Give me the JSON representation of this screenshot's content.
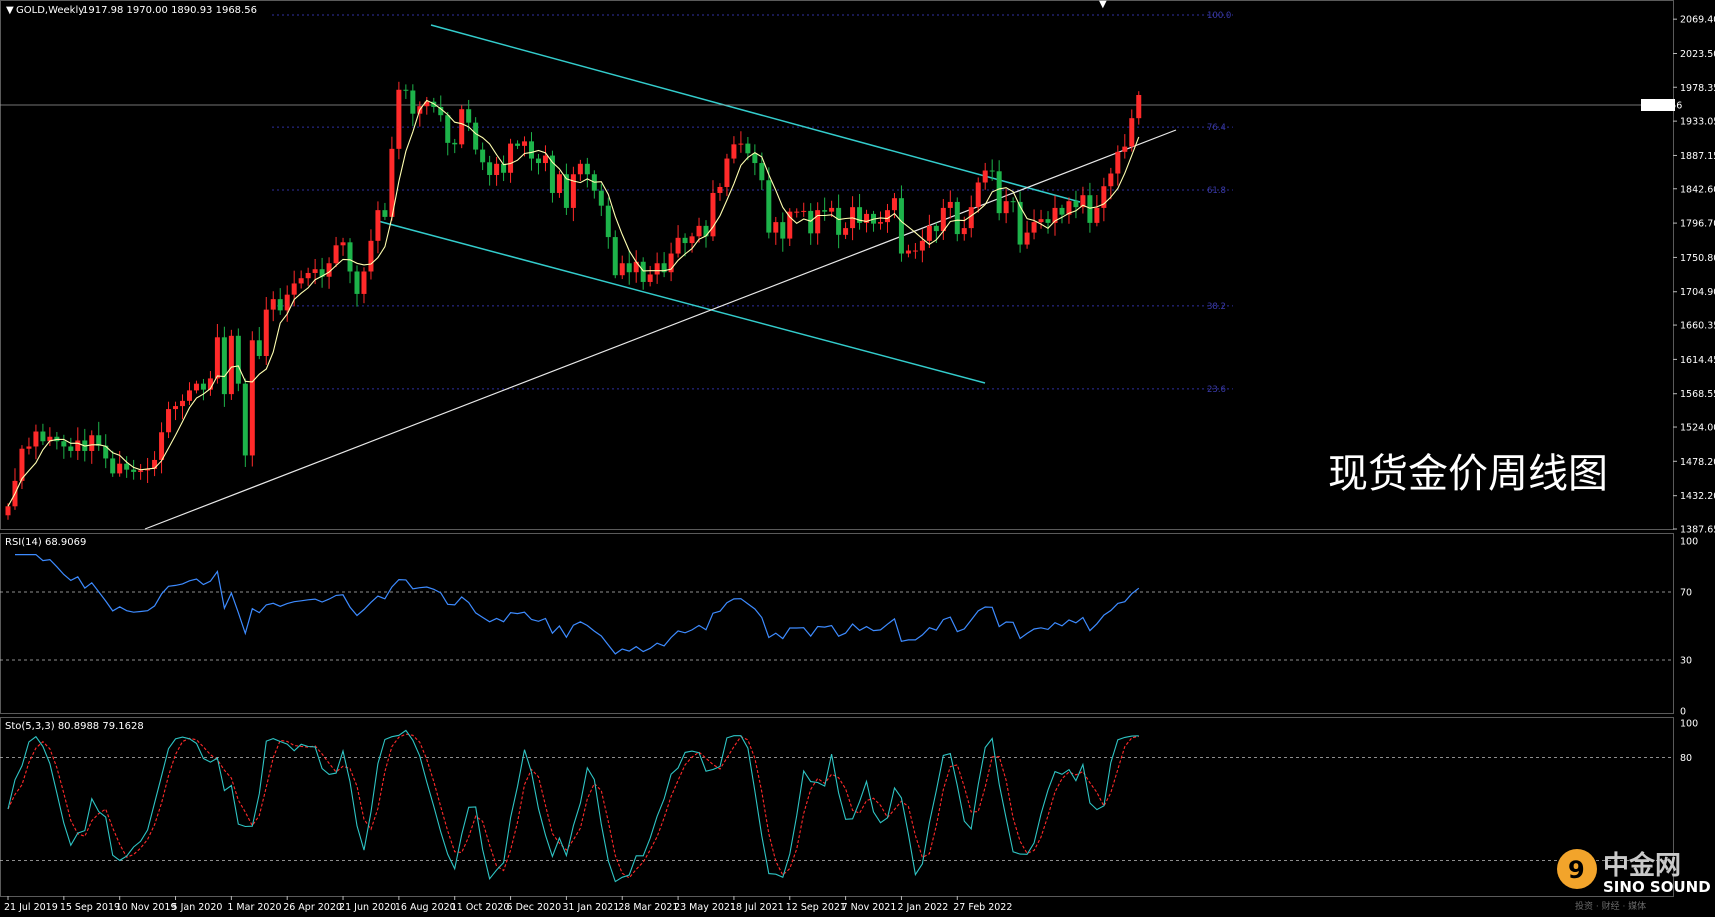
{
  "chart_data": [
    {
      "type": "candlestick",
      "panel": "main",
      "title": "GOLD,Weekly",
      "ohlc_header": "1917.98 1970.00 1890.93 1968.56",
      "current_price": "1968.56",
      "overlay_text": "现货金价周线图",
      "ylim": [
        1387.65,
        2092.35
      ],
      "y_ticks": [
        "2069.40",
        "2023.50",
        "1978.35",
        "1933.05",
        "1887.15",
        "1842.60",
        "1796.70",
        "1750.80",
        "1704.90",
        "1660.35",
        "1614.45",
        "1568.55",
        "1524.00",
        "1478.20",
        "1432.20",
        "1387.65"
      ],
      "x_ticks": [
        "21 Jul 2019",
        "15 Sep 2019",
        "10 Nov 2019",
        "5 Jan 2020",
        "1 Mar 2020",
        "26 Apr 2020",
        "21 Jun 2020",
        "16 Aug 2020",
        "11 Oct 2020",
        "6 Dec 2020",
        "31 Jan 2021",
        "28 Mar 2021",
        "23 May 2021",
        "18 Jul 2021",
        "12 Sep 2021",
        "7 Nov 2021",
        "2 Jan 2022",
        "27 Feb 2022"
      ],
      "fib_levels": [
        {
          "label": "100.0",
          "value": 2075
        },
        {
          "label": "76.4",
          "value": 1925
        },
        {
          "label": "61.8",
          "value": 1841
        },
        {
          "label": "38.2",
          "value": 1686
        },
        {
          "label": "23.6",
          "value": 1575
        }
      ],
      "close_series": [
        1418,
        1452,
        1495,
        1498,
        1518,
        1505,
        1511,
        1505,
        1498,
        1492,
        1506,
        1492,
        1513,
        1499,
        1482,
        1462,
        1475,
        1467,
        1464,
        1466,
        1468,
        1480,
        1517,
        1548,
        1552,
        1559,
        1573,
        1582,
        1574,
        1589,
        1644,
        1568,
        1646,
        1582,
        1486,
        1640,
        1619,
        1681,
        1695,
        1680,
        1701,
        1716,
        1723,
        1730,
        1735,
        1725,
        1743,
        1767,
        1771,
        1732,
        1702,
        1732,
        1773,
        1814,
        1805,
        1896,
        1975,
        1974,
        1943,
        1953,
        1959,
        1952,
        1941,
        1904,
        1902,
        1949,
        1931,
        1895,
        1878,
        1861,
        1876,
        1864,
        1903,
        1900,
        1906,
        1883,
        1877,
        1887,
        1837,
        1862,
        1817,
        1862,
        1876,
        1862,
        1840,
        1820,
        1778,
        1727,
        1743,
        1731,
        1745,
        1718,
        1728,
        1743,
        1731,
        1756,
        1777,
        1770,
        1779,
        1793,
        1779,
        1837,
        1845,
        1883,
        1902,
        1903,
        1890,
        1877,
        1854,
        1784,
        1798,
        1776,
        1812,
        1812,
        1813,
        1783,
        1814,
        1812,
        1817,
        1781,
        1790,
        1818,
        1797,
        1809,
        1796,
        1798,
        1814,
        1830,
        1756,
        1760,
        1760,
        1773,
        1793,
        1786,
        1817,
        1825,
        1782,
        1790,
        1818,
        1851,
        1867,
        1866,
        1810,
        1826,
        1825,
        1768,
        1784,
        1798,
        1802,
        1797,
        1817,
        1808,
        1826,
        1818,
        1834,
        1797,
        1817,
        1846,
        1863,
        1892,
        1899,
        1937,
        1968
      ],
      "ma_line_color": "#ffffb0",
      "bull_color": "#ff2a2a",
      "bear_color": "#1db34a"
    },
    {
      "type": "line",
      "panel": "rsi",
      "title": "RSI(14) 68.9069",
      "ylim": [
        0,
        100
      ],
      "y_ticks": [
        "100",
        "70",
        "30",
        "0"
      ],
      "levels": [
        70,
        30
      ],
      "line_color": "#3d8bff"
    },
    {
      "type": "line",
      "panel": "stochastic",
      "title": "Sto(5,3,3) 80.8988 79.1628",
      "ylim": [
        0,
        100
      ],
      "y_ticks": [
        "100",
        "80"
      ],
      "levels": [
        80,
        20
      ],
      "main_color": "#2ec4c4",
      "signal_color": "#ff2a2a"
    }
  ],
  "watermark": {
    "cn": "中金网",
    "en": "SINO SOUND",
    "sub": "投资 · 财经 · 媒体"
  }
}
